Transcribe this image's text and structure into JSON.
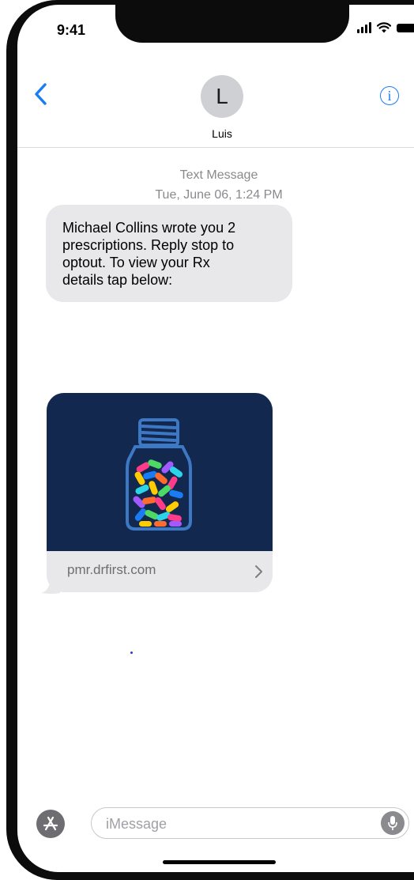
{
  "status_bar": {
    "time": "9:41"
  },
  "header": {
    "avatar_initial": "L",
    "contact_name": "Luis"
  },
  "conversation": {
    "service_label": "Text Message",
    "timestamp": "Tue, June 06, 1:24 PM",
    "message": {
      "line1": "Michael Collins wrote you 2",
      "line2": "prescriptions. Reply stop to",
      "line3": "optout. To view your Rx",
      "line4": "details tap below:"
    },
    "link_preview": {
      "domain": "pmr.drfirst.com",
      "image_icon": "pill-bottle-illustration"
    }
  },
  "compose": {
    "placeholder": "iMessage",
    "apps_icon": "app-store-icon",
    "mic_icon": "microphone-icon"
  },
  "colors": {
    "accent": "#1a7cf5",
    "bubble_gray": "#e8e8ea",
    "preview_bg": "#12284f",
    "meta_text": "#8a8a8e"
  }
}
